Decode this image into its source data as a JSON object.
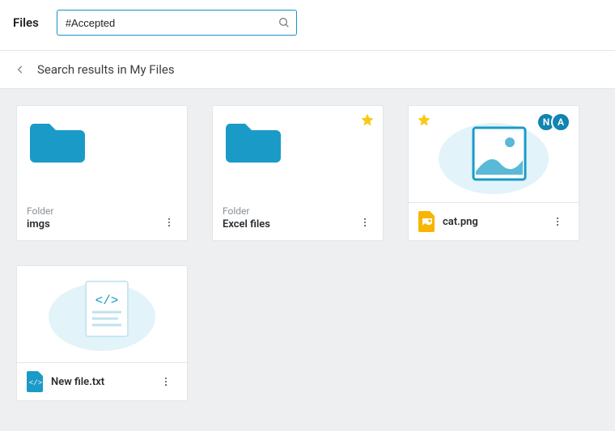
{
  "header": {
    "title": "Files"
  },
  "search": {
    "value": "#Accepted"
  },
  "results": {
    "label": "Search results in My Files"
  },
  "items": [
    {
      "kind": "folder",
      "type_label": "Folder",
      "name": "imgs",
      "starred": false,
      "avatars": []
    },
    {
      "kind": "folder",
      "type_label": "Folder",
      "name": "Excel files",
      "starred": true,
      "avatars": []
    },
    {
      "kind": "image",
      "name": "cat.png",
      "starred": true,
      "avatars": [
        "N",
        "A"
      ]
    },
    {
      "kind": "code",
      "name": "New file.txt",
      "starred": false,
      "avatars": []
    }
  ],
  "colors": {
    "brand": "#1a9bc7",
    "star": "#f7ca18",
    "pageBg": "#edeff1"
  }
}
